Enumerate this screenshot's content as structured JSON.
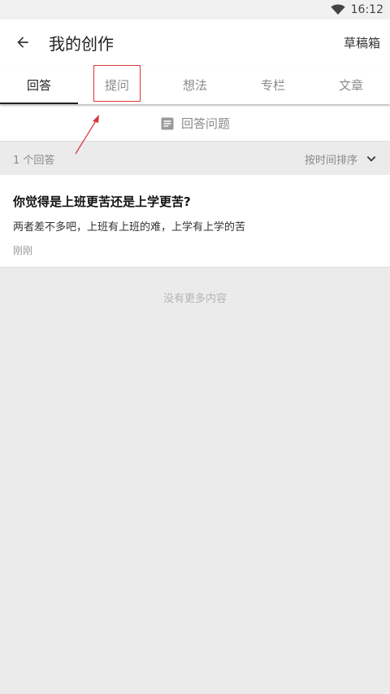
{
  "status": {
    "time": "16:12",
    "wifi_icon": "wifi-icon"
  },
  "header": {
    "title": "我的创作",
    "back_icon": "arrow-left-icon",
    "drafts": "草稿箱"
  },
  "tabs": [
    {
      "label": "回答",
      "active": true
    },
    {
      "label": "提问",
      "active": false,
      "highlighted": true
    },
    {
      "label": "想法",
      "active": false
    },
    {
      "label": "专栏",
      "active": false
    },
    {
      "label": "文章",
      "active": false
    }
  ],
  "answer_button": {
    "label": "回答问题",
    "icon": "document-icon"
  },
  "list_header": {
    "count": "1 个回答",
    "sort_label": "按时间排序",
    "sort_icon": "chevron-down-icon"
  },
  "answers": [
    {
      "question": "你觉得是上班更苦还是上学更苦?",
      "excerpt": "两者差不多吧，上班有上班的难，上学有上学的苦",
      "time": "刚刚"
    }
  ],
  "footer": {
    "no_more": "没有更多内容"
  },
  "colors": {
    "highlight": "#d9363e",
    "annotation_arrow": "#d9363e"
  }
}
